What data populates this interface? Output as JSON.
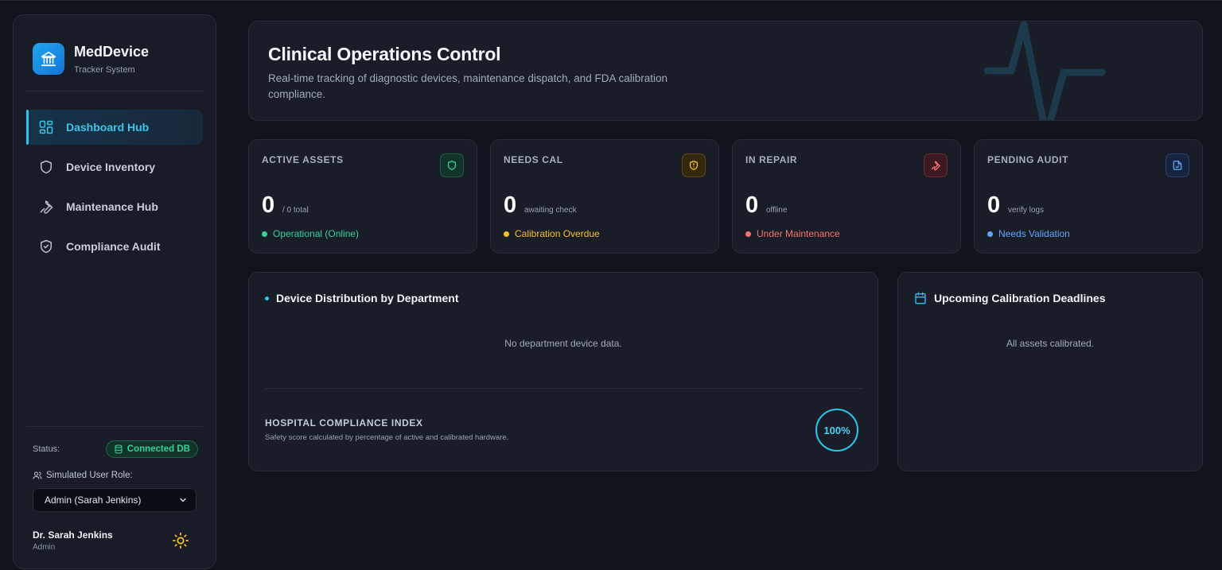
{
  "brand": {
    "title": "MedDevice",
    "subtitle": "Tracker System"
  },
  "nav": [
    {
      "label": "Dashboard Hub",
      "icon": "dashboard-grid-icon",
      "active": true
    },
    {
      "label": "Device Inventory",
      "icon": "shield-icon",
      "active": false
    },
    {
      "label": "Maintenance Hub",
      "icon": "wrench-icon",
      "active": false
    },
    {
      "label": "Compliance Audit",
      "icon": "shield-check-icon",
      "active": false
    }
  ],
  "sidebar_footer": {
    "status_label": "Status:",
    "status_badge": "Connected DB",
    "role_label": "Simulated User Role:",
    "role_value": "Admin (Sarah Jenkins)",
    "user_name": "Dr. Sarah Jenkins",
    "user_role": "Admin"
  },
  "hero": {
    "title": "Clinical Operations Control",
    "description": "Real-time tracking of diagnostic devices, maintenance dispatch, and FDA calibration compliance."
  },
  "stats": [
    {
      "label": "ACTIVE ASSETS",
      "value": "0",
      "sub": "/ 0 total",
      "status": "Operational (Online)",
      "color": "#34d399",
      "icon": "shield-icon"
    },
    {
      "label": "NEEDS CAL",
      "value": "0",
      "sub": "awaiting check",
      "status": "Calibration Overdue",
      "color": "#fbbf24",
      "icon": "shield-alert-icon"
    },
    {
      "label": "IN REPAIR",
      "value": "0",
      "sub": "offline",
      "status": "Under Maintenance",
      "color": "#f87171",
      "icon": "wrench-icon"
    },
    {
      "label": "PENDING AUDIT",
      "value": "0",
      "sub": "verify logs",
      "status": "Needs Validation",
      "color": "#60a5fa",
      "icon": "file-check-icon"
    }
  ],
  "distribution": {
    "title": "Device Distribution by Department",
    "empty": "No department device data.",
    "compliance_title": "HOSPITAL COMPLIANCE INDEX",
    "compliance_desc": "Safety score calculated by percentage of active and calibrated hardware.",
    "compliance_value": "100%"
  },
  "deadlines": {
    "title": "Upcoming Calibration Deadlines",
    "empty": "All assets calibrated."
  },
  "colors": {
    "accent": "#29c5ec",
    "background": "#0f131b",
    "card": "#181d27"
  }
}
